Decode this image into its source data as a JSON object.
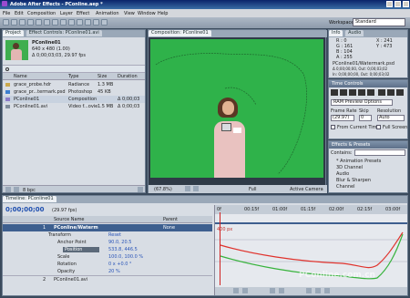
{
  "app": {
    "title": "Adobe After Effects - PConline.aep *",
    "menu": [
      "File",
      "Edit",
      "Composition",
      "Layer",
      "Effect",
      "Animation",
      "View",
      "Window",
      "Help"
    ],
    "workspace_label": "Workspace:",
    "workspace_value": "Standard"
  },
  "project": {
    "tabs": [
      "Project",
      "Effect Controls: PConline01.avi"
    ],
    "comp_name": "PConline01",
    "comp_res": "640 x 480 (1.00)",
    "comp_dur": "Δ 0;00;03;03, 29.97 fps",
    "headers": [
      "Name",
      "Type",
      "Size",
      "Duration"
    ],
    "items": [
      {
        "name": "grace_probe.hdr",
        "type": "Radiance",
        "size": "1.3 MB",
        "dur": ""
      },
      {
        "name": "grace_pr...termark.psd",
        "type": "Photoshop",
        "size": "45 KB",
        "dur": ""
      },
      {
        "name": "PConline01",
        "type": "Composition",
        "size": "",
        "dur": "Δ 0;00;03"
      },
      {
        "name": "PConline01.avi",
        "type": "Video f...ovie",
        "size": "1.5 MB",
        "dur": "Δ 0;00;03"
      }
    ],
    "bpc": "8 bpc"
  },
  "comp": {
    "tab": "Composition: PConline01",
    "zoom": "(67.8%)",
    "res": "Full",
    "camera": "Active Camera"
  },
  "info": {
    "tabs": [
      "Info",
      "Audio"
    ],
    "R": "R : 0",
    "G": "G : 161",
    "B": "B : 104",
    "A": "A : 255",
    "X": "X : 241",
    "Y": "Y : 473",
    "name": "PConline01/Watermark.psd",
    "dur": "Δ 0;00;00;00, Out: 0;00;03;02",
    "in": "In: 0;00;00;00, Out: 0;00;03;02"
  },
  "time_controls": {
    "title": "Time Controls",
    "ram_preview": "RAM Preview Options",
    "frame_rate_label": "Frame Rate",
    "frame_rate": "(29.97)",
    "skip_label": "Skip",
    "skip": "0",
    "resolution_label": "Resolution",
    "resolution": "Auto",
    "from_current": "From Current Time",
    "full_screen": "Full Screen"
  },
  "effects": {
    "title": "Effects & Presets",
    "contains": "Contains:",
    "items": [
      "* Animation Presets",
      "3D Channel",
      "Audio",
      "Blur & Sharpen",
      "Channel"
    ]
  },
  "timeline": {
    "tab": "Timeline: PConline01",
    "time": "0;00;00;00",
    "fps": "(29.97 fps)",
    "col_source": "Source Name",
    "col_parent": "Parent",
    "layer_num": "1",
    "layer_name": "PConline/Waterm",
    "layer_parent": "None",
    "transform": "Transform",
    "reset": "Reset",
    "props": [
      {
        "name": "Anchor Point",
        "value": "90.0, 20.5"
      },
      {
        "name": "Position",
        "value": "533.8, 446.5"
      },
      {
        "name": "Scale",
        "value": "100.0, 100.0 %"
      },
      {
        "name": "Rotation",
        "value": "0 x +0.0 °"
      },
      {
        "name": "Opacity",
        "value": "20 %"
      }
    ],
    "layer2_num": "2",
    "layer2_name": "PConline01.avi",
    "ruler": [
      "0f",
      "00:15f",
      "01:00f",
      "01:15f",
      "02:00f",
      "02:15f",
      "03:00f"
    ],
    "graph_label": "400 px",
    "watermark": "PConline.com.cn"
  }
}
